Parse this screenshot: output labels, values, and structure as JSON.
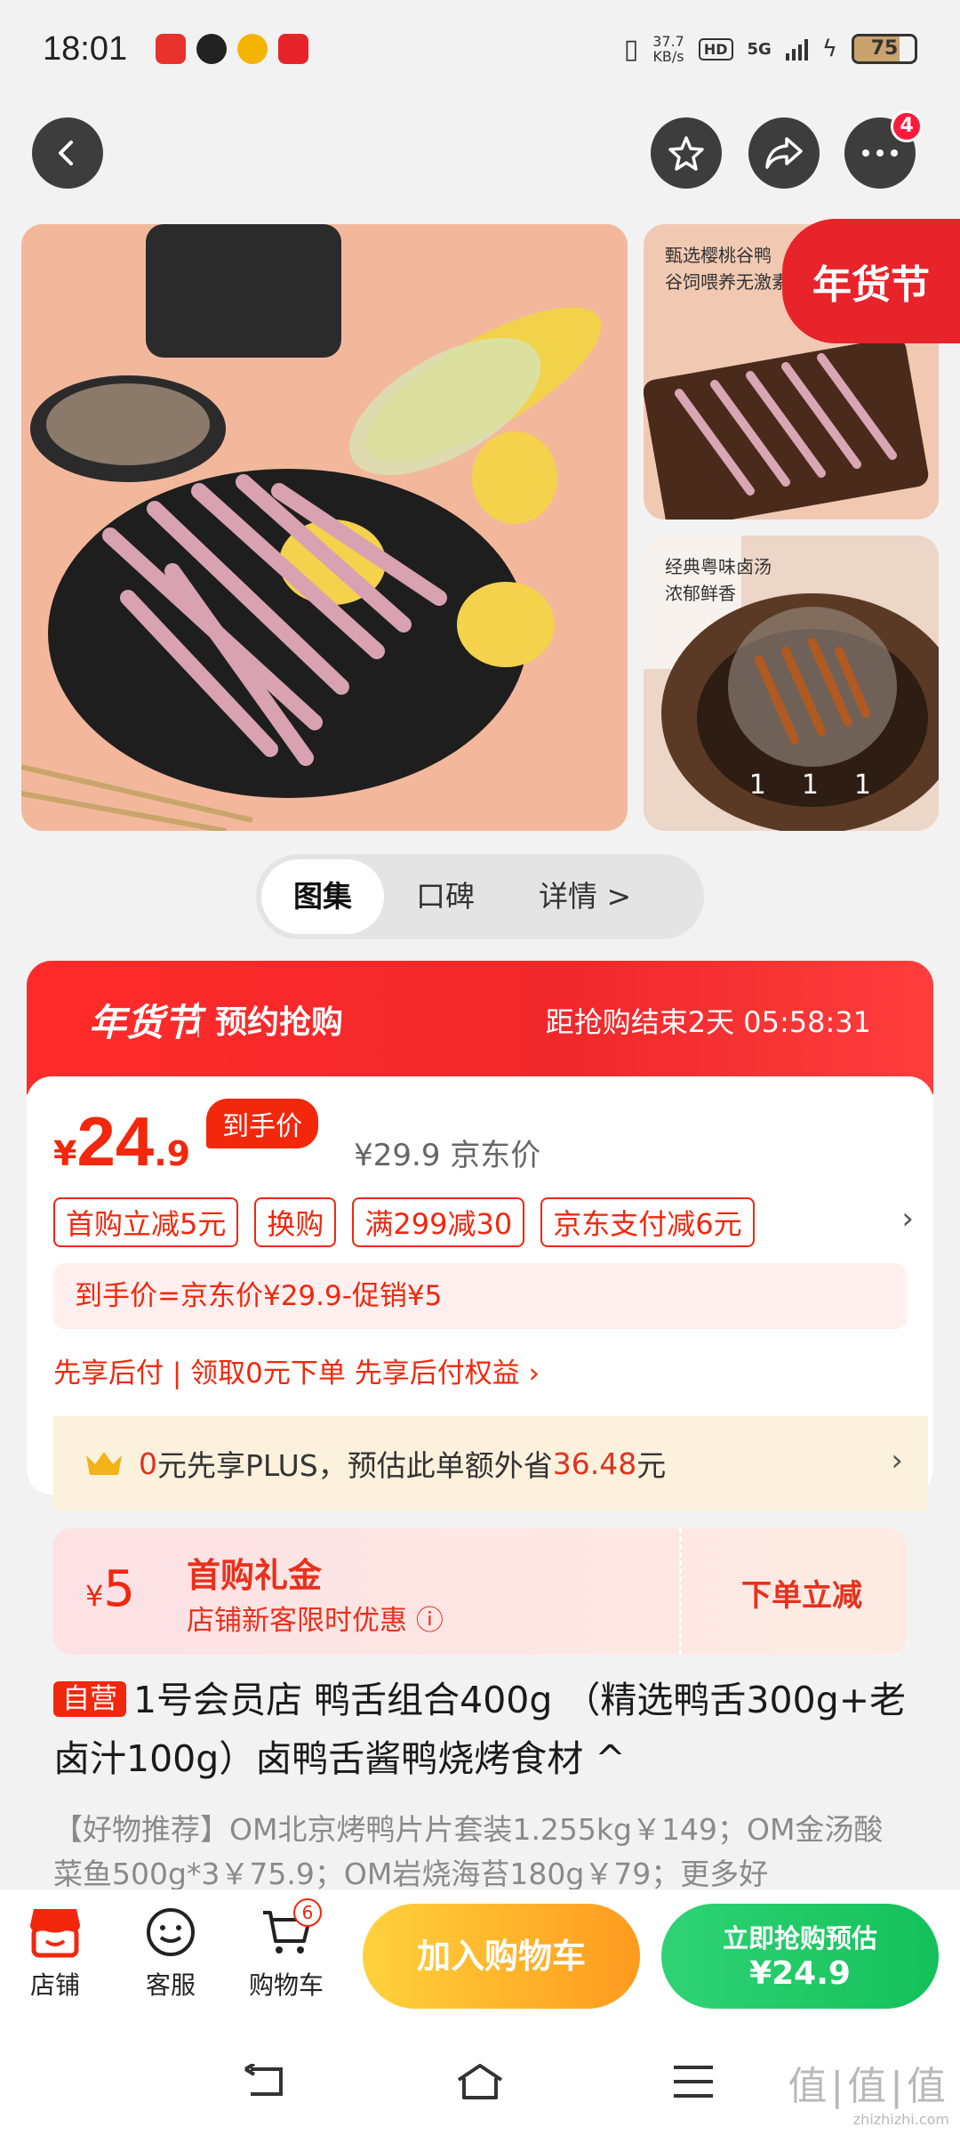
{
  "status_bar": {
    "time": "18:01",
    "net_speed_value": "37.7",
    "net_speed_unit": "KB/s",
    "hd_label": "HD",
    "signal_label": "5G",
    "battery": "75",
    "battery_level": 0.75
  },
  "nav": {
    "more_badge": "4"
  },
  "gallery": {
    "side1_caption_line1": "甄选樱桃谷鸭",
    "side1_caption_line2": "谷饲喂养无激素",
    "side2_caption_line1": "经典粤味卤汤",
    "side2_caption_line2": "浓郁鲜香",
    "festival_tag": "年货节",
    "index": "1",
    "total": "11"
  },
  "tabs": {
    "gallery": "图集",
    "reviews": "口碑",
    "details": "详情 >"
  },
  "promo": {
    "festival": "年货节",
    "label": "预约抢购",
    "countdown": "距抢购结束2天  05:58:31"
  },
  "price": {
    "currency": "¥",
    "integer": "24",
    "decimal": ".9",
    "final_tag": "到手价",
    "jd_price": "¥29.9 京东价"
  },
  "coupons": [
    "首购立减5元",
    "换购",
    "满299减30",
    "京东支付减6元"
  ],
  "formula": "到手价=京东价¥29.9-促销¥5",
  "bnpl": "先享后付 | 领取0元下单 先享后付权益 ›",
  "plus": {
    "prefix": "0",
    "text1": "元先享PLUS，预估此单额外省",
    "amount": "36.48",
    "text2": "元"
  },
  "gift": {
    "currency": "¥",
    "amount": "5",
    "title": "首购礼金",
    "subtitle": "店铺新客限时优惠 ⓘ",
    "action": "下单立减"
  },
  "product": {
    "self_tag": "自营",
    "title": "1号会员店 鸭舌组合400g （精选鸭舌300g+老卤汁100g）卤鸭舌酱鸭烧烤食材 ^",
    "desc": "【好物推荐】OM北京烤鸭片片套装1.255kg￥149；OM金汤酸菜鱼500g*3￥75.9；OM岩烧海苔180g￥79；更多好"
  },
  "actionbar": {
    "store": "店铺",
    "service": "客服",
    "cart": "购物车",
    "cart_count": "6",
    "add_to_cart": "加入购物车",
    "buy_line1": "立即抢购预估",
    "buy_line2": "¥24.9"
  },
  "watermark": {
    "main": "值|值|值",
    "domain": "zhizhizhi.com"
  }
}
